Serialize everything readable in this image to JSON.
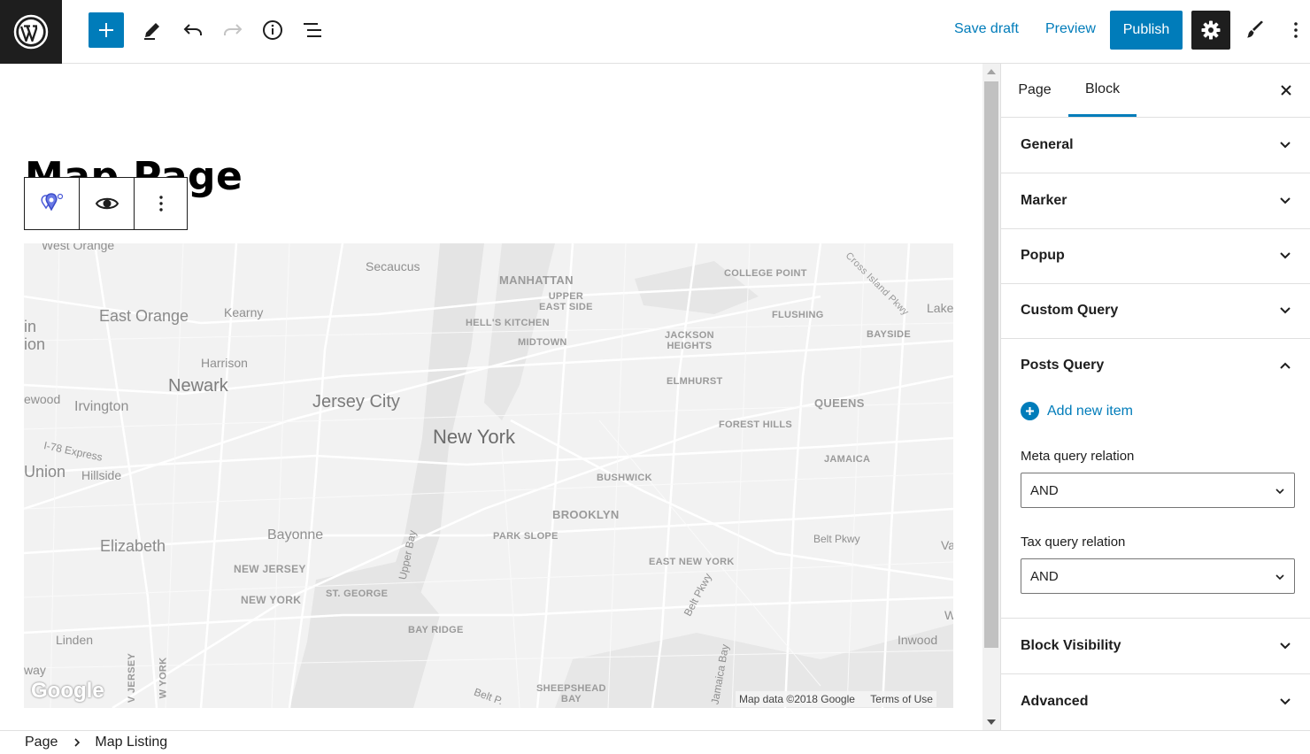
{
  "colors": {
    "accent": "#007cba",
    "dark": "#1e1e1e"
  },
  "topbar": {
    "logo_icon": "wordpress-logo-icon",
    "add_icon": "plus-icon",
    "tools": [
      "pencil-icon",
      "undo-icon",
      "redo-icon",
      "info-icon",
      "list-view-icon"
    ],
    "save_draft": "Save draft",
    "preview": "Preview",
    "publish": "Publish",
    "settings_icon": "gear-icon",
    "styles_icon": "brush-icon",
    "more_icon": "more-vertical-icon"
  },
  "editor": {
    "title": "Map Page",
    "block_toolbar": [
      "map-marker-icon",
      "eye-icon",
      "more-vertical-icon"
    ]
  },
  "map": {
    "labels": {
      "west_orange": "West Orange",
      "secaucus": "Secaucus",
      "manhattan": "MANHATTAN",
      "upper_east_side": "UPPER\nEAST SIDE",
      "college_point": "COLLEGE POINT",
      "cross_island": "Cross Island Pkwy",
      "east_orange": "East Orange",
      "kearny": "Kearny",
      "hells_kitchen": "HELL'S KITCHEN",
      "flushing": "FLUSHING",
      "lake": "Lake",
      "midtown": "MIDTOWN",
      "jackson_heights": "JACKSON\nHEIGHTS",
      "bayside": "BAYSIDE",
      "in": "in",
      "ion": "ion",
      "harrison": "Harrison",
      "newark": "Newark",
      "elmhurst": "ELMHURST",
      "ewood": "ewood",
      "irvington": "Irvington",
      "jersey_city": "Jersey City",
      "queens": "QUEENS",
      "forest_hills": "FOREST HILLS",
      "new_york": "New York",
      "i78": "I-78 Express",
      "jamaica": "JAMAICA",
      "union": "Union",
      "hillside": "Hillside",
      "bushwick": "BUSHWICK",
      "brooklyn": "BROOKLYN",
      "elizabeth": "Elizabeth",
      "bayonne": "Bayonne",
      "upper_bay": "Upper Bay",
      "park_slope": "PARK SLOPE",
      "belt_pkwy": "Belt Pkwy",
      "va": "Va",
      "new_jersey": "NEW JERSEY",
      "east_new_york": "EAST NEW YORK",
      "new_york_state": "NEW YORK",
      "st_george": "ST. GEORGE",
      "belt_pkwy2": "Belt Pkwy",
      "w": "W",
      "linden": "Linden",
      "bay_ridge": "BAY RIDGE",
      "inwood": "Inwood",
      "way": "way",
      "jersey_v": "V JERSEY",
      "york_v": "W YORK",
      "sheepshead": "SHEEPSHEAD\nBAY",
      "belt_p": "Belt P.",
      "jamaica_bay": "Jamaica Bay"
    },
    "google": "Google",
    "attribution": "Map data ©2018 Google",
    "terms": "Terms of Use"
  },
  "sidebar": {
    "tabs": [
      "Page",
      "Block"
    ],
    "active_tab": "Block",
    "close_icon": "close-icon",
    "panels": {
      "general": "General",
      "marker": "Marker",
      "popup": "Popup",
      "custom_query": "Custom Query",
      "posts_query": "Posts Query",
      "block_visibility": "Block Visibility",
      "advanced": "Advanced"
    },
    "posts_query": {
      "add_new_item": "Add new item",
      "meta_label": "Meta query relation",
      "meta_value": "AND",
      "tax_label": "Tax query relation",
      "tax_value": "AND"
    }
  },
  "footer": {
    "breadcrumb": [
      "Page",
      "Map Listing"
    ]
  }
}
